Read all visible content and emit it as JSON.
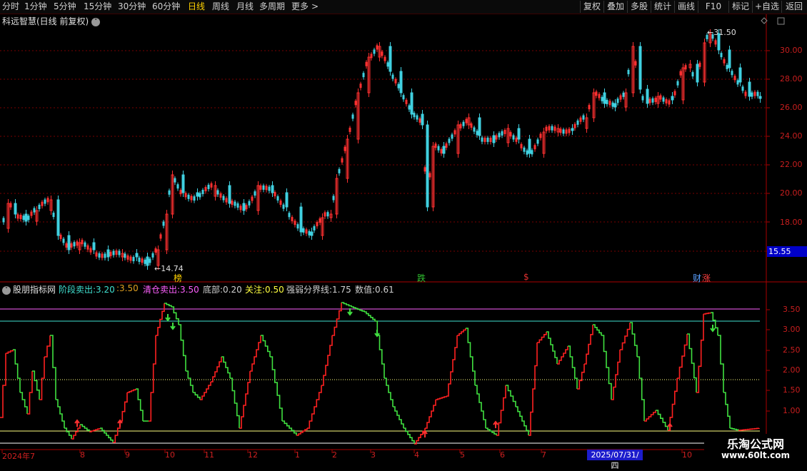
{
  "toolbar": {
    "periods": [
      "分时",
      "1分钟",
      "5分钟",
      "15分钟",
      "30分钟",
      "60分钟",
      "日线",
      "周线",
      "月线",
      "多周期",
      "更多"
    ],
    "active_period": "日线",
    "more_arrow": ">",
    "right_buttons": [
      "复权",
      "叠加",
      "多股",
      "统计",
      "画线",
      "F10",
      "标记",
      "+自选",
      "返回"
    ]
  },
  "main_panel": {
    "title": "科远智慧(日线 前复权)",
    "high_label": "31.50",
    "low_label": "14.74",
    "current_price": "15.55",
    "y_ticks": [
      "30.00",
      "28.00",
      "26.00",
      "24.00",
      "22.00",
      "20.00",
      "18.00"
    ],
    "markers": [
      {
        "text": "榜",
        "color": "#ffd200"
      },
      {
        "text": "跌",
        "color": "#30c030"
      },
      {
        "text": "$",
        "color": "#e03030"
      },
      {
        "text": "财",
        "color": "#5aa0ff"
      },
      {
        "text": "涨",
        "color": "#ff4040"
      }
    ]
  },
  "indicator_panel": {
    "name": "股朋指标网",
    "items": [
      {
        "label": "阶段卖出:",
        "value": "3.20",
        "color": "#40e0d0"
      },
      {
        "label": ":",
        "value": "3.50",
        "color": "#e0a020"
      },
      {
        "label": "清仓卖出:",
        "value": "3.50",
        "color": "#ff60ff"
      },
      {
        "label": "底部:",
        "value": "0.20",
        "color": "#d0d0d0"
      },
      {
        "label": "关注:",
        "value": "0.50",
        "color": "#ffff40"
      },
      {
        "label": "强弱分界线:",
        "value": "1.75",
        "color": "#d0d0d0"
      },
      {
        "label": "数值:",
        "value": "0.61",
        "color": "#d0d0d0"
      }
    ],
    "y_ticks": [
      "3.50",
      "3.00",
      "2.50",
      "2.00",
      "1.50",
      "1.00"
    ]
  },
  "x_axis": {
    "labels": [
      "2024年7",
      "8",
      "9",
      "10",
      "11",
      "12",
      "1",
      "2",
      "3",
      "4",
      "5",
      "6",
      "7",
      "10"
    ],
    "cursor_date": "2025/07/31/四"
  },
  "watermark": {
    "line1": "乐淘公式网",
    "line2": "www.60lt.com"
  },
  "colors": {
    "up": "#ff3030",
    "down": "#40d0e0",
    "ind_up": "#ff2020",
    "ind_down": "#40e040",
    "grid": "#7a0000",
    "axis": "#aa0000"
  }
}
